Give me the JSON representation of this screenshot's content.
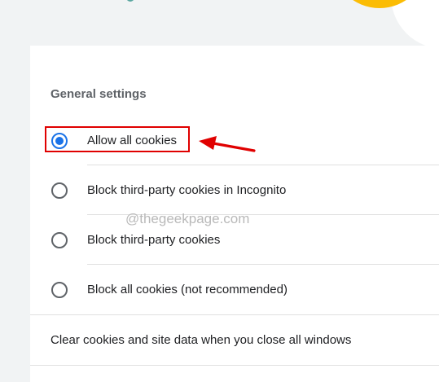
{
  "section_title": "General settings",
  "cookie_options": [
    {
      "label": "Allow all cookies",
      "selected": true
    },
    {
      "label": "Block third-party cookies in Incognito",
      "selected": false
    },
    {
      "label": "Block third-party cookies",
      "selected": false
    },
    {
      "label": "Block all cookies (not recommended)",
      "selected": false
    }
  ],
  "clear_on_exit_label": "Clear cookies and site data when you close all windows",
  "watermark": "@thegeekpage.com",
  "colors": {
    "accent": "#1a73e8",
    "annotation": "#e00000",
    "banner_yellow": "#fbbc04"
  }
}
